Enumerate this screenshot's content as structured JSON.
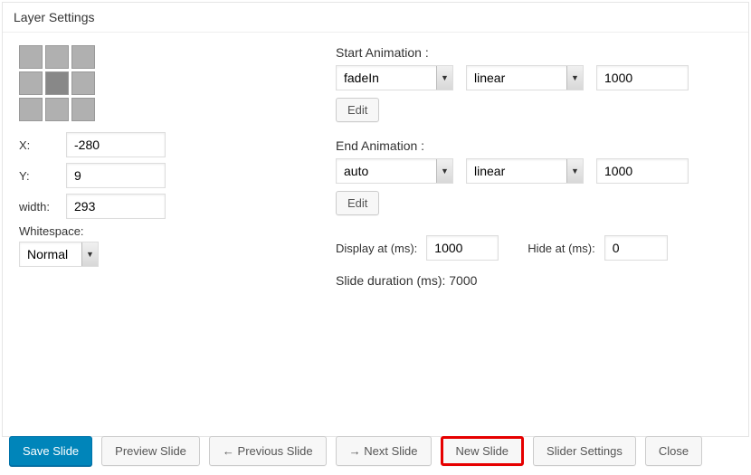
{
  "panel": {
    "title": "Layer Settings"
  },
  "position": {
    "x_label": "X:",
    "y_label": "Y:",
    "width_label": "width:",
    "whitespace_label": "Whitespace:",
    "x_value": "-280",
    "y_value": "9",
    "width_value": "293",
    "whitespace_value": "Normal"
  },
  "start_anim": {
    "label": "Start Animation :",
    "effect": "fadeIn",
    "easing": "linear",
    "duration": "1000",
    "edit": "Edit"
  },
  "end_anim": {
    "label": "End Animation :",
    "effect": "auto",
    "easing": "linear",
    "duration": "1000",
    "edit": "Edit"
  },
  "timing": {
    "display_label": "Display at (ms): ",
    "display_value": "1000",
    "hide_label": "Hide at (ms): ",
    "hide_value": "0",
    "slide_duration_text": "Slide duration (ms): 7000"
  },
  "footer": {
    "save": "Save Slide",
    "preview": "Preview Slide",
    "prev": "← Previous Slide",
    "next": "→ Next Slide",
    "new": "New Slide",
    "settings": "Slider Settings",
    "close": "Close"
  }
}
